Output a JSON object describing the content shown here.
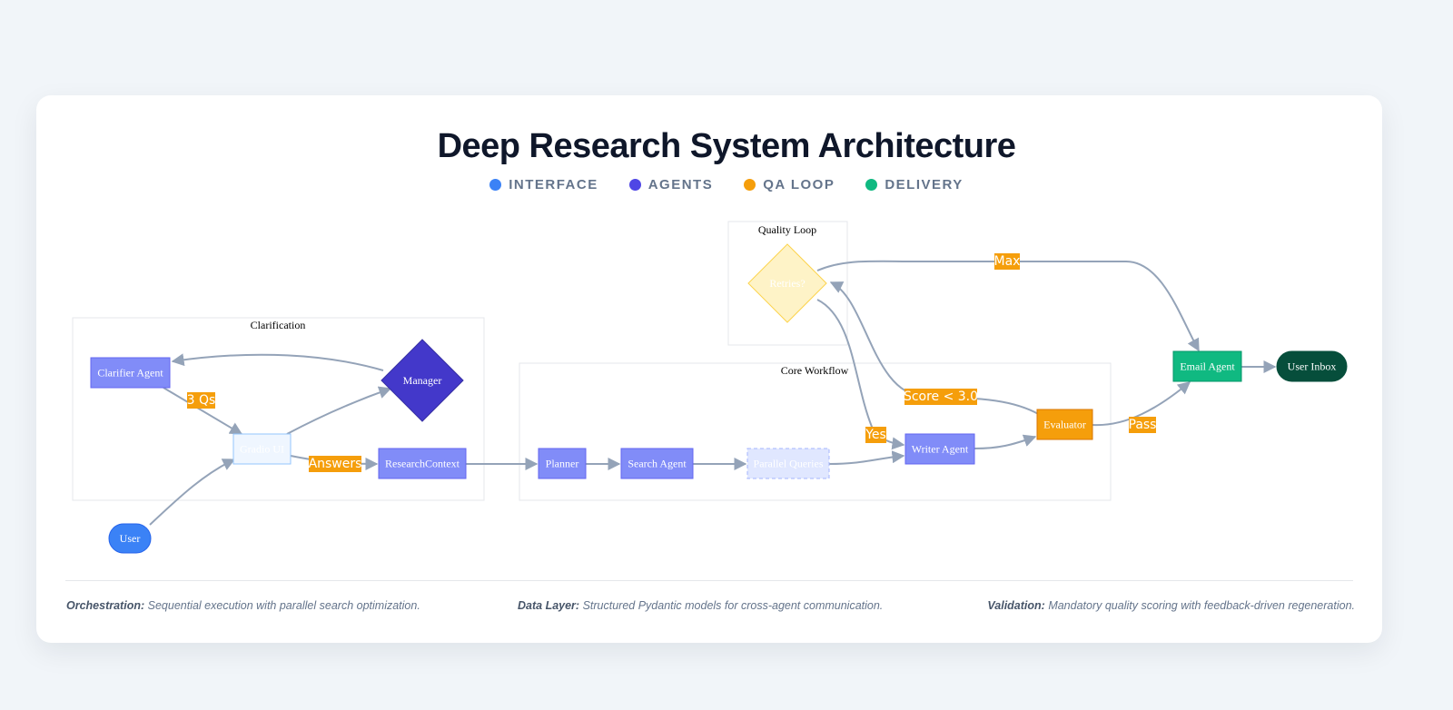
{
  "title": "Deep Research System Architecture",
  "legend": [
    {
      "label": "INTERFACE",
      "color": "#3b82f6"
    },
    {
      "label": "AGENTS",
      "color": "#4f46e5"
    },
    {
      "label": "QA LOOP",
      "color": "#f59e0b"
    },
    {
      "label": "DELIVERY",
      "color": "#10b981"
    }
  ],
  "clusters": {
    "clarification": "Clarification",
    "core": "Core Workflow",
    "quality": "Quality Loop"
  },
  "nodes": {
    "clarifier": "Clarifier Agent",
    "manager": "Manager",
    "gradio": "Gradio UI",
    "context": "ResearchContext",
    "user": "User",
    "planner": "Planner",
    "search": "Search Agent",
    "parallel": "Parallel Queries",
    "writer": "Writer Agent",
    "evaluator": "Evaluator",
    "retries": "Retries?",
    "email": "Email Agent",
    "inbox": "User Inbox"
  },
  "edge_labels": {
    "qs": "3 Qs",
    "answers": "Answers",
    "score": "Score < 3.0",
    "yes": "Yes",
    "max": "Max",
    "pass": "Pass"
  },
  "colors": {
    "agent": "#818cf8",
    "manager": "#4338ca",
    "qa": "#f59e0b",
    "delivery": "#10b981",
    "inbox": "#064e3b",
    "edge": "#94a3b8"
  },
  "footer": [
    {
      "label": "Orchestration:",
      "text": "Sequential execution with parallel search optimization."
    },
    {
      "label": "Data Layer:",
      "text": "Structured Pydantic models for cross-agent communication."
    },
    {
      "label": "Validation:",
      "text": "Mandatory quality scoring with feedback-driven regeneration."
    }
  ]
}
